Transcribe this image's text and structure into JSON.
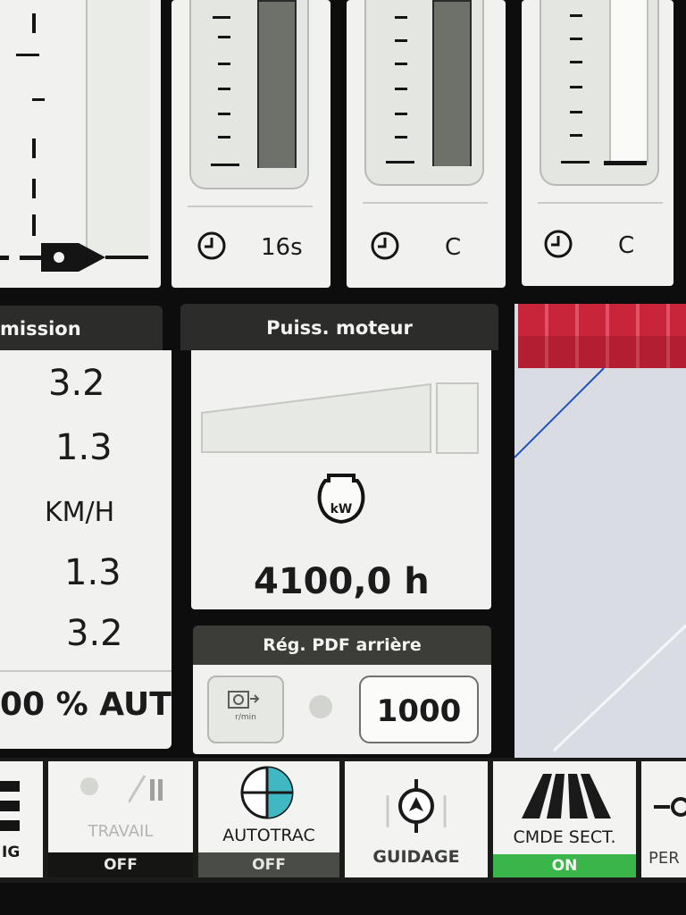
{
  "gauges": [
    {
      "timer": "16s",
      "level": 1.0
    },
    {
      "timer": "C",
      "level": 1.0
    },
    {
      "timer": "C",
      "level": 0.0
    }
  ],
  "transmission": {
    "title": "mission",
    "values": [
      "3.2",
      "1.3",
      "KM/H",
      "1.3",
      "3.2"
    ],
    "status": "00 % AUT"
  },
  "engine": {
    "title": "Puiss. moteur",
    "icon_text": "kW",
    "hours": "4100,0 h"
  },
  "pto": {
    "title": "Rég. PDF arrière",
    "icon_text": "r/min",
    "value": "1000"
  },
  "toolbar": {
    "left_label": "IG",
    "travail": {
      "label": "TRAVAIL",
      "state": "OFF"
    },
    "autotrac": {
      "label": "AUTOTRAC",
      "state": "OFF"
    },
    "guidage": {
      "label": "GUIDAGE"
    },
    "cmde_sect": {
      "label": "CMDE SECT.",
      "state": "ON"
    },
    "per": {
      "label": "PER"
    }
  },
  "colors": {
    "on_green": "#39b54a",
    "map_red": "#c8243a",
    "autotrac_teal": "#3fb8c4"
  }
}
